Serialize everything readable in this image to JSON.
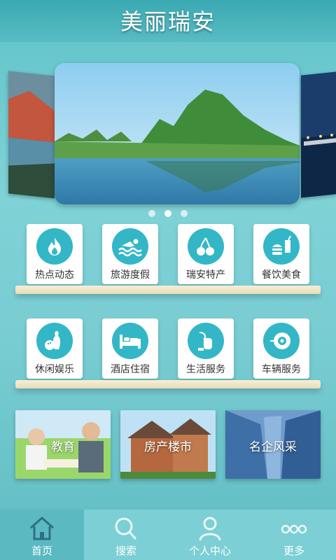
{
  "header": {
    "title": "美丽瑞安"
  },
  "carousel": {
    "slide_count": 3,
    "active_index": 1
  },
  "grid": {
    "row1": [
      {
        "label": "热点动态",
        "icon": "flame-icon"
      },
      {
        "label": "旅游度假",
        "icon": "swimmer-icon"
      },
      {
        "label": "瑞安特产",
        "icon": "cherry-icon"
      },
      {
        "label": "餐饮美食",
        "icon": "burger-drink-icon"
      }
    ],
    "row2": [
      {
        "label": "休闲娱乐",
        "icon": "bowling-icon"
      },
      {
        "label": "酒店住宿",
        "icon": "bed-icon"
      },
      {
        "label": "生活服务",
        "icon": "vacuum-icon"
      },
      {
        "label": "车辆服务",
        "icon": "tire-icon"
      }
    ]
  },
  "banners": [
    {
      "label": "教育"
    },
    {
      "label": "房产楼市"
    },
    {
      "label": "名企风采"
    }
  ],
  "tabbar": {
    "items": [
      {
        "label": "首页",
        "icon": "home-icon"
      },
      {
        "label": "搜索",
        "icon": "search-icon"
      },
      {
        "label": "个人中心",
        "icon": "user-icon"
      },
      {
        "label": "更多",
        "icon": "more-icon"
      }
    ],
    "active_index": 0
  },
  "colors": {
    "accent": "#33b7c7",
    "background": "#7fd2d6",
    "shelf": "#efe5c4"
  }
}
